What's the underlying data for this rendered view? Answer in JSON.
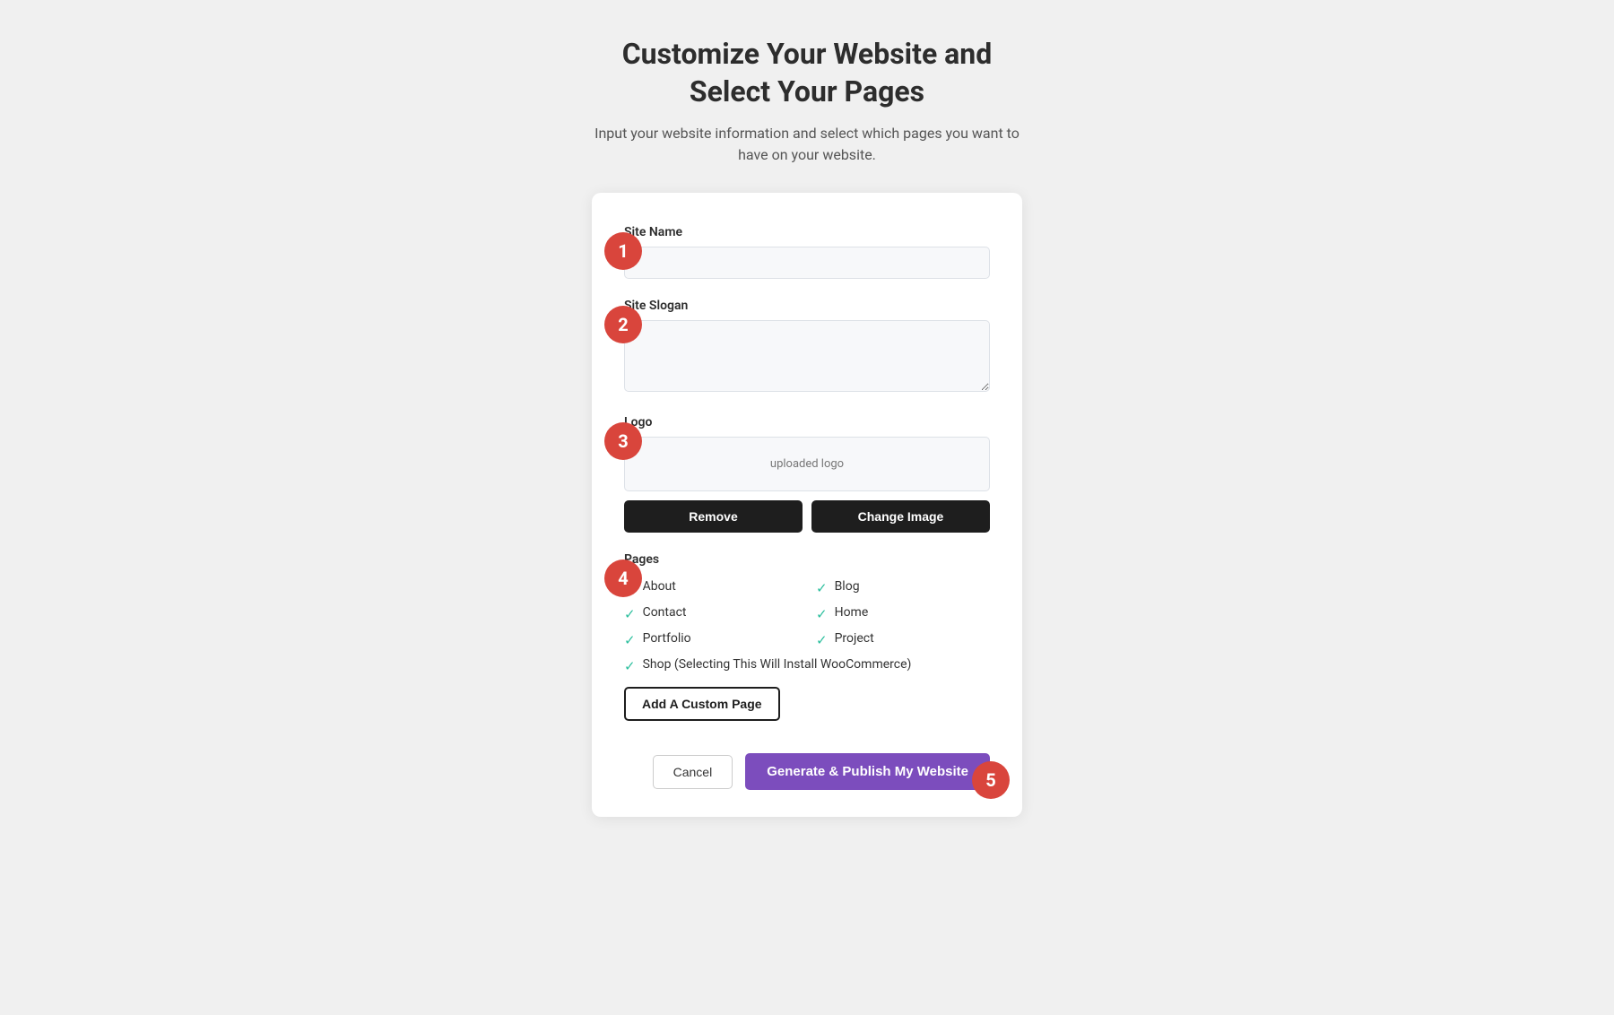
{
  "page": {
    "title_line1": "Customize Your Website and",
    "title_line2": "Select Your Pages",
    "subtitle": "Input your website information and select which pages you want to have on your website."
  },
  "form": {
    "site_name_label": "Site Name",
    "site_name_placeholder": "",
    "site_slogan_label": "Site Slogan",
    "site_slogan_placeholder": "",
    "logo_label": "Logo",
    "logo_placeholder": "uploaded logo",
    "remove_button": "Remove",
    "change_image_button": "Change Image"
  },
  "pages": {
    "label": "Pages",
    "items_col1": [
      {
        "name": "About",
        "checked": true
      },
      {
        "name": "Contact",
        "checked": true
      },
      {
        "name": "Portfolio",
        "checked": true
      }
    ],
    "items_col2": [
      {
        "name": "Blog",
        "checked": true
      },
      {
        "name": "Home",
        "checked": true
      },
      {
        "name": "Project",
        "checked": true
      }
    ],
    "items_wide": [
      {
        "name": "Shop (Selecting This Will Install WooCommerce)",
        "checked": true
      }
    ],
    "add_custom_button": "Add A Custom Page"
  },
  "footer": {
    "cancel_button": "Cancel",
    "publish_button": "Generate & Publish My Website"
  },
  "steps": {
    "step1": "1",
    "step2": "2",
    "step3": "3",
    "step4": "4",
    "step5": "5"
  },
  "icons": {
    "checkmark": "✓"
  }
}
